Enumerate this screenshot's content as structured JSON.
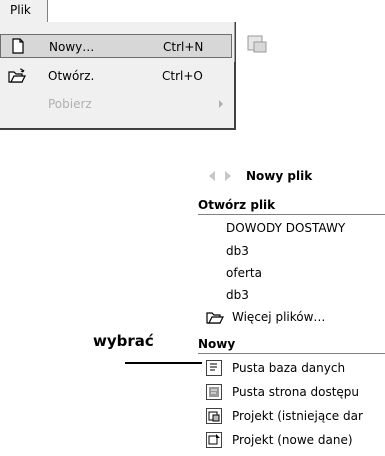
{
  "menu": {
    "title": "Plik",
    "items": [
      {
        "label": "Nowy…",
        "shortcut": "Ctrl+N",
        "icon": "new-document-icon",
        "state": "highlighted"
      },
      {
        "label": "Otwórz.",
        "shortcut": "Ctrl+O",
        "icon": "open-folder-icon",
        "state": "normal"
      },
      {
        "label": "Pobierz",
        "shortcut": "",
        "icon": "",
        "state": "disabled",
        "has_submenu": true
      }
    ]
  },
  "pane": {
    "title": "Nowy plik",
    "open_section": {
      "title": "Otwórz plik",
      "files": [
        "DOWODY DOSTAWY",
        "db3",
        "oferta",
        "db3"
      ],
      "more": "Więcej plików…"
    },
    "new_section": {
      "title": "Nowy",
      "items": [
        "Pusta baza danych",
        "Pusta strona dostępu",
        "Projekt (istniejące dar",
        "Projekt (nowe dane)"
      ]
    }
  },
  "callout": {
    "label": "wybrać"
  }
}
